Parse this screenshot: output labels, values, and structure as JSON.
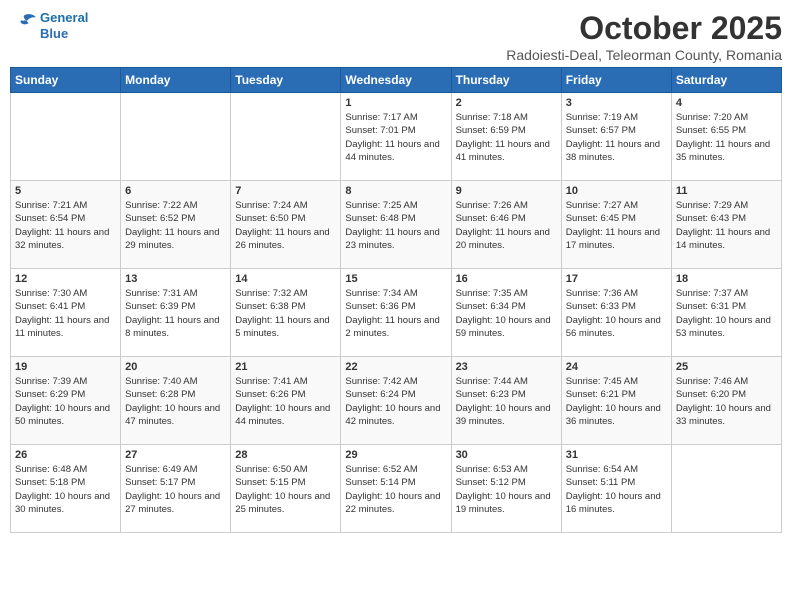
{
  "header": {
    "logo_line1": "General",
    "logo_line2": "Blue",
    "month_title": "October 2025",
    "subtitle": "Radoiesti-Deal, Teleorman County, Romania"
  },
  "days_of_week": [
    "Sunday",
    "Monday",
    "Tuesday",
    "Wednesday",
    "Thursday",
    "Friday",
    "Saturday"
  ],
  "weeks": [
    {
      "days": [
        {
          "num": "",
          "info": ""
        },
        {
          "num": "",
          "info": ""
        },
        {
          "num": "",
          "info": ""
        },
        {
          "num": "1",
          "info": "Sunrise: 7:17 AM\nSunset: 7:01 PM\nDaylight: 11 hours and 44 minutes."
        },
        {
          "num": "2",
          "info": "Sunrise: 7:18 AM\nSunset: 6:59 PM\nDaylight: 11 hours and 41 minutes."
        },
        {
          "num": "3",
          "info": "Sunrise: 7:19 AM\nSunset: 6:57 PM\nDaylight: 11 hours and 38 minutes."
        },
        {
          "num": "4",
          "info": "Sunrise: 7:20 AM\nSunset: 6:55 PM\nDaylight: 11 hours and 35 minutes."
        }
      ]
    },
    {
      "days": [
        {
          "num": "5",
          "info": "Sunrise: 7:21 AM\nSunset: 6:54 PM\nDaylight: 11 hours and 32 minutes."
        },
        {
          "num": "6",
          "info": "Sunrise: 7:22 AM\nSunset: 6:52 PM\nDaylight: 11 hours and 29 minutes."
        },
        {
          "num": "7",
          "info": "Sunrise: 7:24 AM\nSunset: 6:50 PM\nDaylight: 11 hours and 26 minutes."
        },
        {
          "num": "8",
          "info": "Sunrise: 7:25 AM\nSunset: 6:48 PM\nDaylight: 11 hours and 23 minutes."
        },
        {
          "num": "9",
          "info": "Sunrise: 7:26 AM\nSunset: 6:46 PM\nDaylight: 11 hours and 20 minutes."
        },
        {
          "num": "10",
          "info": "Sunrise: 7:27 AM\nSunset: 6:45 PM\nDaylight: 11 hours and 17 minutes."
        },
        {
          "num": "11",
          "info": "Sunrise: 7:29 AM\nSunset: 6:43 PM\nDaylight: 11 hours and 14 minutes."
        }
      ]
    },
    {
      "days": [
        {
          "num": "12",
          "info": "Sunrise: 7:30 AM\nSunset: 6:41 PM\nDaylight: 11 hours and 11 minutes."
        },
        {
          "num": "13",
          "info": "Sunrise: 7:31 AM\nSunset: 6:39 PM\nDaylight: 11 hours and 8 minutes."
        },
        {
          "num": "14",
          "info": "Sunrise: 7:32 AM\nSunset: 6:38 PM\nDaylight: 11 hours and 5 minutes."
        },
        {
          "num": "15",
          "info": "Sunrise: 7:34 AM\nSunset: 6:36 PM\nDaylight: 11 hours and 2 minutes."
        },
        {
          "num": "16",
          "info": "Sunrise: 7:35 AM\nSunset: 6:34 PM\nDaylight: 10 hours and 59 minutes."
        },
        {
          "num": "17",
          "info": "Sunrise: 7:36 AM\nSunset: 6:33 PM\nDaylight: 10 hours and 56 minutes."
        },
        {
          "num": "18",
          "info": "Sunrise: 7:37 AM\nSunset: 6:31 PM\nDaylight: 10 hours and 53 minutes."
        }
      ]
    },
    {
      "days": [
        {
          "num": "19",
          "info": "Sunrise: 7:39 AM\nSunset: 6:29 PM\nDaylight: 10 hours and 50 minutes."
        },
        {
          "num": "20",
          "info": "Sunrise: 7:40 AM\nSunset: 6:28 PM\nDaylight: 10 hours and 47 minutes."
        },
        {
          "num": "21",
          "info": "Sunrise: 7:41 AM\nSunset: 6:26 PM\nDaylight: 10 hours and 44 minutes."
        },
        {
          "num": "22",
          "info": "Sunrise: 7:42 AM\nSunset: 6:24 PM\nDaylight: 10 hours and 42 minutes."
        },
        {
          "num": "23",
          "info": "Sunrise: 7:44 AM\nSunset: 6:23 PM\nDaylight: 10 hours and 39 minutes."
        },
        {
          "num": "24",
          "info": "Sunrise: 7:45 AM\nSunset: 6:21 PM\nDaylight: 10 hours and 36 minutes."
        },
        {
          "num": "25",
          "info": "Sunrise: 7:46 AM\nSunset: 6:20 PM\nDaylight: 10 hours and 33 minutes."
        }
      ]
    },
    {
      "days": [
        {
          "num": "26",
          "info": "Sunrise: 6:48 AM\nSunset: 5:18 PM\nDaylight: 10 hours and 30 minutes."
        },
        {
          "num": "27",
          "info": "Sunrise: 6:49 AM\nSunset: 5:17 PM\nDaylight: 10 hours and 27 minutes."
        },
        {
          "num": "28",
          "info": "Sunrise: 6:50 AM\nSunset: 5:15 PM\nDaylight: 10 hours and 25 minutes."
        },
        {
          "num": "29",
          "info": "Sunrise: 6:52 AM\nSunset: 5:14 PM\nDaylight: 10 hours and 22 minutes."
        },
        {
          "num": "30",
          "info": "Sunrise: 6:53 AM\nSunset: 5:12 PM\nDaylight: 10 hours and 19 minutes."
        },
        {
          "num": "31",
          "info": "Sunrise: 6:54 AM\nSunset: 5:11 PM\nDaylight: 10 hours and 16 minutes."
        },
        {
          "num": "",
          "info": ""
        }
      ]
    }
  ]
}
